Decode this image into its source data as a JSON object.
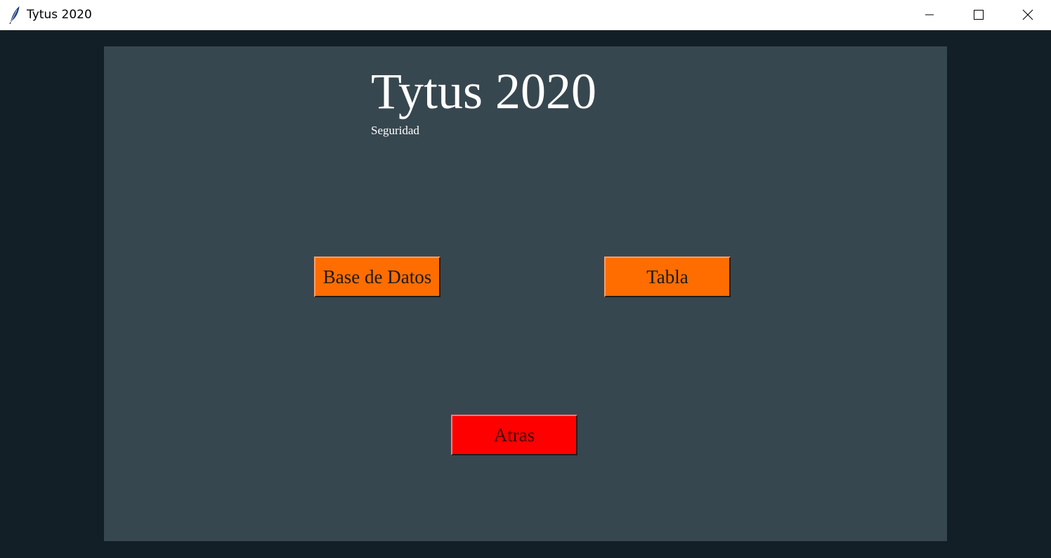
{
  "window": {
    "title": "Tytus 2020",
    "app_icon": "feather-icon",
    "controls": {
      "minimize": "minimize-icon",
      "maximize": "maximize-icon",
      "close": "close-icon"
    }
  },
  "main": {
    "title": "Tytus 2020",
    "subtitle": "Seguridad",
    "buttons": {
      "database_label": "Base de Datos",
      "table_label": "Tabla",
      "back_label": "Atras"
    }
  },
  "colors": {
    "outer_background": "#121f26",
    "panel_background": "#37474f",
    "primary_button": "#ff6d00",
    "back_button": "#ff0000",
    "title_text": "#ffffff"
  }
}
